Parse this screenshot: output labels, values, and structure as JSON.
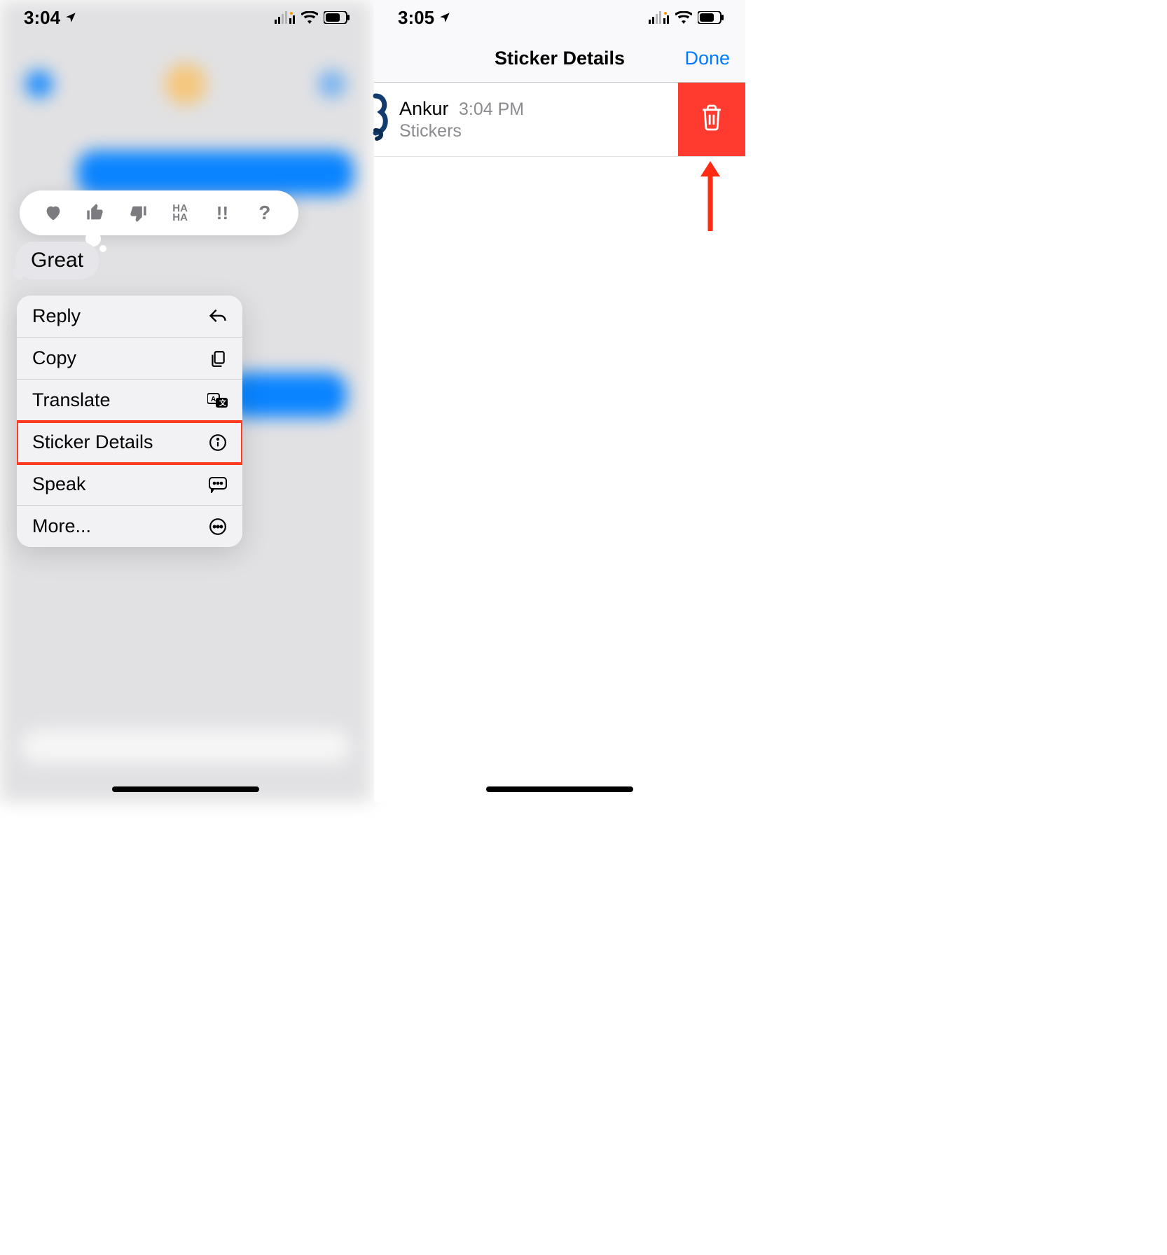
{
  "left": {
    "status": {
      "time": "3:04"
    },
    "message_text": "Great",
    "tapbacks": [
      "heart",
      "thumbs-up",
      "thumbs-down",
      "haha",
      "exclaim",
      "question"
    ],
    "menu": {
      "reply": "Reply",
      "copy": "Copy",
      "translate": "Translate",
      "sticker_details": "Sticker Details",
      "speak": "Speak",
      "more": "More..."
    }
  },
  "right": {
    "status": {
      "time": "3:05"
    },
    "nav": {
      "title": "Sticker Details",
      "done": "Done"
    },
    "row": {
      "name": "Ankur",
      "time": "3:04 PM",
      "subtitle": "Stickers"
    }
  }
}
